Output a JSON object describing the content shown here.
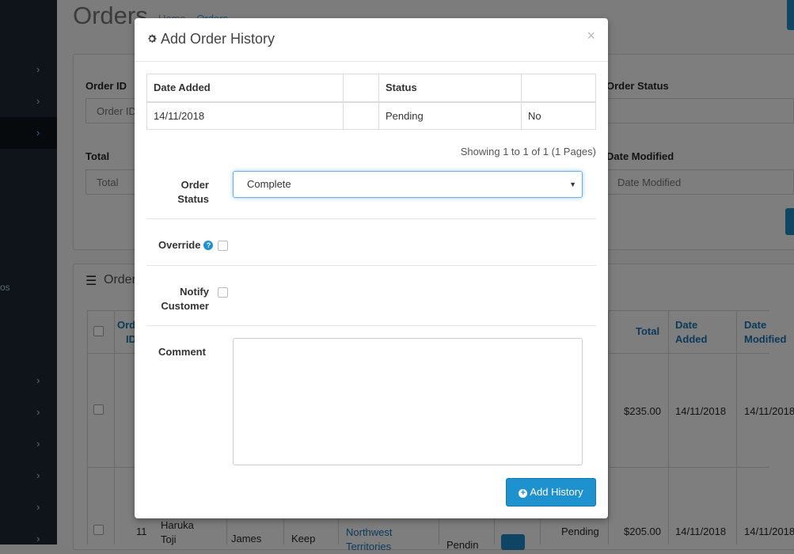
{
  "background": {
    "page_title": "Orders",
    "breadcrumb": [
      "Home",
      "Orders"
    ],
    "sidebar_fragment": "os",
    "filter": {
      "order_id_label": "Order ID",
      "order_id_placeholder": "Order ID",
      "total_label": "Total",
      "total_placeholder": "Total",
      "order_status_label": "Order Status",
      "date_modified_label": "Date Modified",
      "date_modified_placeholder": "Date Modified"
    },
    "list": {
      "heading": "Order",
      "col_order_id": "Order ID",
      "col_total": "Total",
      "col_date_added": "Date Added",
      "col_date_modified": "Date Modified",
      "rows": [
        {
          "total": "$235.00",
          "date_added": "14/11/2018",
          "date_modified": "14/11/2018"
        },
        {
          "order_id": "11",
          "customer": "Haruka Toji",
          "cells": [
            "James",
            "Keep"
          ],
          "region": "Northwest Territories",
          "status_a": "Pendin",
          "status_b": "Pending",
          "total": "$205.00",
          "date_added": "14/11/2018",
          "date_modified": "14/11/2018"
        }
      ]
    }
  },
  "modal": {
    "title": "Add Order History",
    "close_label": "×",
    "history_table": {
      "headers": [
        "Date Added",
        "",
        "Status",
        ""
      ],
      "rows": [
        [
          "14/11/2018",
          "",
          "Pending",
          "No"
        ]
      ]
    },
    "pagination": "Showing 1 to 1 of 1 (1 Pages)",
    "order_status_label": "Order Status",
    "order_status_value": "Complete",
    "override_label": "Override",
    "help_glyph": "?",
    "notify_label": "Notify Customer",
    "comment_label": "Comment",
    "comment_value": "",
    "submit_label": "Add History",
    "colors": {
      "primary": "#1e91cf",
      "focus": "#66afe9"
    }
  }
}
